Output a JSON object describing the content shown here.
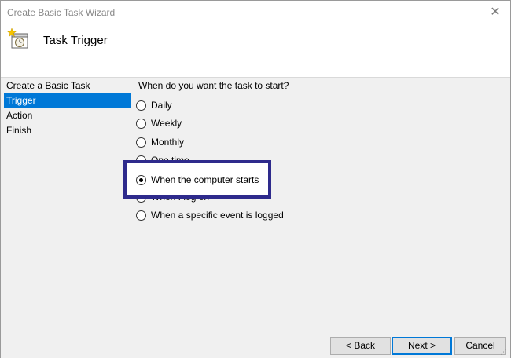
{
  "window": {
    "title": "Create Basic Task Wizard",
    "close_icon": "close-icon"
  },
  "header": {
    "title": "Task Trigger",
    "icon": "task-scheduler-icon"
  },
  "sidebar": {
    "items": [
      {
        "label": "Create a Basic Task",
        "selected": false
      },
      {
        "label": "Trigger",
        "selected": true
      },
      {
        "label": "Action",
        "selected": false
      },
      {
        "label": "Finish",
        "selected": false
      }
    ]
  },
  "main": {
    "prompt": "When do you want the task to start?",
    "options": [
      {
        "label": "Daily",
        "checked": false
      },
      {
        "label": "Weekly",
        "checked": false
      },
      {
        "label": "Monthly",
        "checked": false
      },
      {
        "label": "One time",
        "checked": false
      },
      {
        "label": "When the computer starts",
        "checked": true
      },
      {
        "label": "When I log on",
        "checked": false
      },
      {
        "label": "When a specific event is logged",
        "checked": false
      }
    ]
  },
  "buttons": {
    "back": "< Back",
    "next": "Next >",
    "cancel": "Cancel"
  },
  "colors": {
    "selection": "#0078d7",
    "highlight_border": "#2e2a8c"
  }
}
